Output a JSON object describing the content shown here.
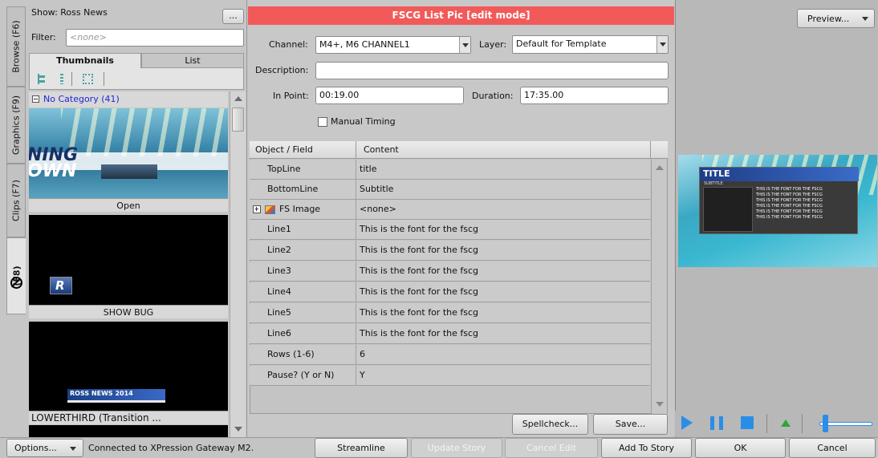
{
  "left_panel": {
    "show_label": "Show: Ross News",
    "ellipsis_button": "...",
    "filter_label": "Filter:",
    "filter_placeholder": "<none>",
    "view_tabs": [
      "Thumbnails",
      "List"
    ],
    "category": "No Category (41)",
    "vertical_tabs": [
      "Browse (F6)",
      "Graphics (F9)",
      "Clips (F7)",
      "(F8)"
    ],
    "thumbnails": [
      {
        "caption": "Open",
        "art_text_1": "NING",
        "art_text_2": "OWN"
      },
      {
        "caption": "SHOW BUG",
        "art_text_1": "R"
      },
      {
        "caption": "LOWERTHIRD (Transition ...",
        "art_text_1": "ROSS NEWS 2014"
      }
    ]
  },
  "editor": {
    "title": "FSCG List Pic [edit mode]",
    "title_color": "#f25a5a",
    "channel_label": "Channel:",
    "channel_value": "M4+, M6 CHANNEL1",
    "layer_label": "Layer:",
    "layer_value": "Default for Template",
    "description_label": "Description:",
    "description_value": "",
    "in_point_label": "In Point:",
    "in_point_value": "00:19.00",
    "duration_label": "Duration:",
    "duration_value": "17:35.00",
    "manual_timing_label": "Manual Timing",
    "manual_timing_checked": false,
    "table_headers": [
      "Object / Field",
      "Content"
    ],
    "rows": [
      {
        "field": "TopLine",
        "content": "title"
      },
      {
        "field": "BottomLine",
        "content": "Subtitle"
      },
      {
        "field": "FS Image",
        "content": "<none>"
      },
      {
        "field": "Line1",
        "content": "This is the font for the fscg"
      },
      {
        "field": "Line2",
        "content": "This is the font for the fscg"
      },
      {
        "field": "Line3",
        "content": "This is the font for the fscg"
      },
      {
        "field": "Line4",
        "content": "This is the font for the fscg"
      },
      {
        "field": "Line5",
        "content": "This is the font for the fscg"
      },
      {
        "field": "Line6",
        "content": "This is the font for the fscg"
      },
      {
        "field": "Rows (1-6)",
        "content": "6"
      },
      {
        "field": "Pause? (Y or N)",
        "content": "Y"
      }
    ],
    "spellcheck_button": "Spellcheck...",
    "save_button": "Save..."
  },
  "preview": {
    "button": "Preview...",
    "art_title": "TITLE",
    "art_subtitle": "SUBTITLE",
    "art_lines": [
      "THIS IS THE FONT FOR THE FSCG",
      "THIS IS THE FONT FOR THE FSCG",
      "THIS IS THE FONT FOR THE FSCG",
      "THIS IS THE FONT FOR THE FSCG",
      "THIS IS THE FONT FOR THE FSCG",
      "THIS IS THE FONT FOR THE FSCG"
    ]
  },
  "bottom_bar": {
    "options_button": "Options...",
    "status": "Connected to XPression Gateway M2.",
    "streamline": "Streamline",
    "update_story": "Update Story",
    "cancel_edit": "Cancel Edit",
    "add_to_story": "Add To Story",
    "ok": "OK",
    "cancel": "Cancel"
  }
}
